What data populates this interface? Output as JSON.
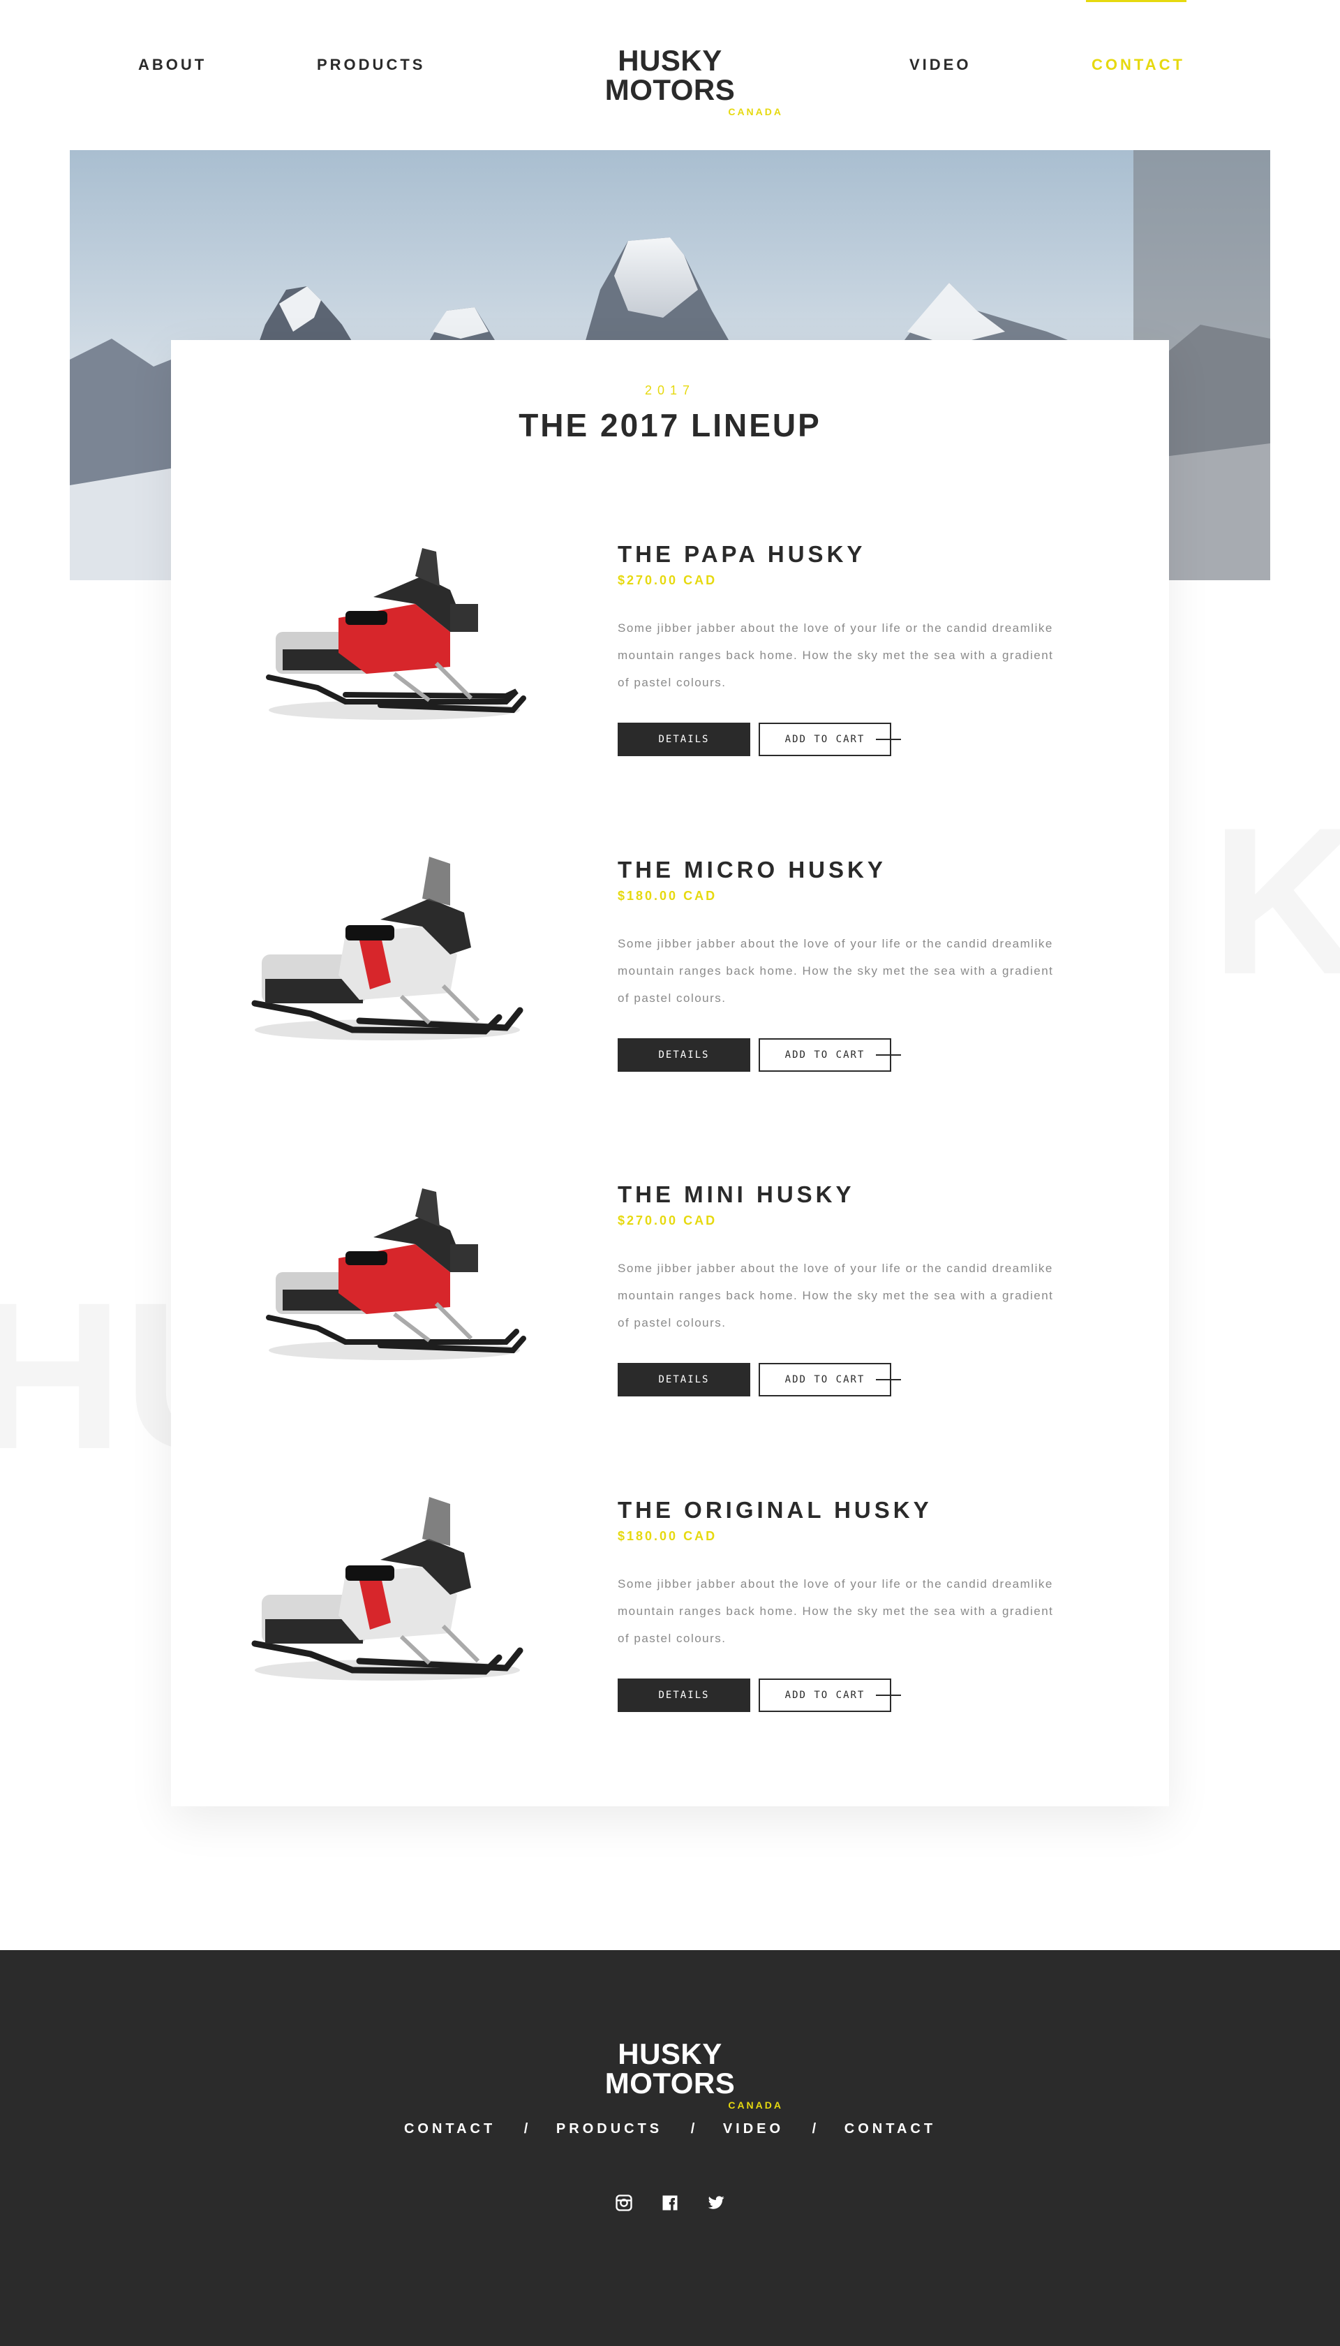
{
  "nav": {
    "about": "ABOUT",
    "products": "PRODUCTS",
    "video": "VIDEO",
    "contact": "CONTACT",
    "active": "contact"
  },
  "brand": {
    "name": "HUSKY MOTORS",
    "region": "CANADA",
    "accent_color": "#e6d90f",
    "dark_color": "#2b2b2b"
  },
  "watermarks": {
    "left": "HU",
    "right": "K"
  },
  "lineup": {
    "year": "2017",
    "title": "THE 2017 LINEUP",
    "products": [
      {
        "name": "THE PAPA HUSKY",
        "price": "$270.00 CAD",
        "description": "Some jibber jabber about the love of your life or the candid dreamlike mountain ranges back home. How the sky met the sea with a gradient of pastel colours.",
        "details_label": "DETAILS",
        "cart_label": "ADD TO CART",
        "image_icon": "snowmobile-red"
      },
      {
        "name": "THE MICRO HUSKY",
        "price": "$180.00 CAD",
        "description": "Some jibber jabber about the love of your life or the candid dreamlike mountain ranges back home. How the sky met the sea with a gradient of pastel colours.",
        "details_label": "DETAILS",
        "cart_label": "ADD TO CART",
        "image_icon": "snowmobile-white"
      },
      {
        "name": "THE MINI HUSKY",
        "price": "$270.00 CAD",
        "description": "Some jibber jabber about the love of your life or the candid dreamlike mountain ranges back home. How the sky met the sea with a gradient of pastel colours.",
        "details_label": "DETAILS",
        "cart_label": "ADD TO CART",
        "image_icon": "snowmobile-red"
      },
      {
        "name": "THE ORIGINAL HUSKY",
        "price": "$180.00 CAD",
        "description": "Some jibber jabber about the love of your life or the candid dreamlike mountain ranges back home. How the sky met the sea with a gradient of pastel colours.",
        "details_label": "DETAILS",
        "cart_label": "ADD TO CART",
        "image_icon": "snowmobile-white"
      }
    ]
  },
  "footer": {
    "links": [
      "CONTACT",
      "PRODUCTS",
      "VIDEO",
      "CONTACT"
    ],
    "separator": "/",
    "social": [
      "instagram-icon",
      "facebook-icon",
      "twitter-icon"
    ]
  }
}
